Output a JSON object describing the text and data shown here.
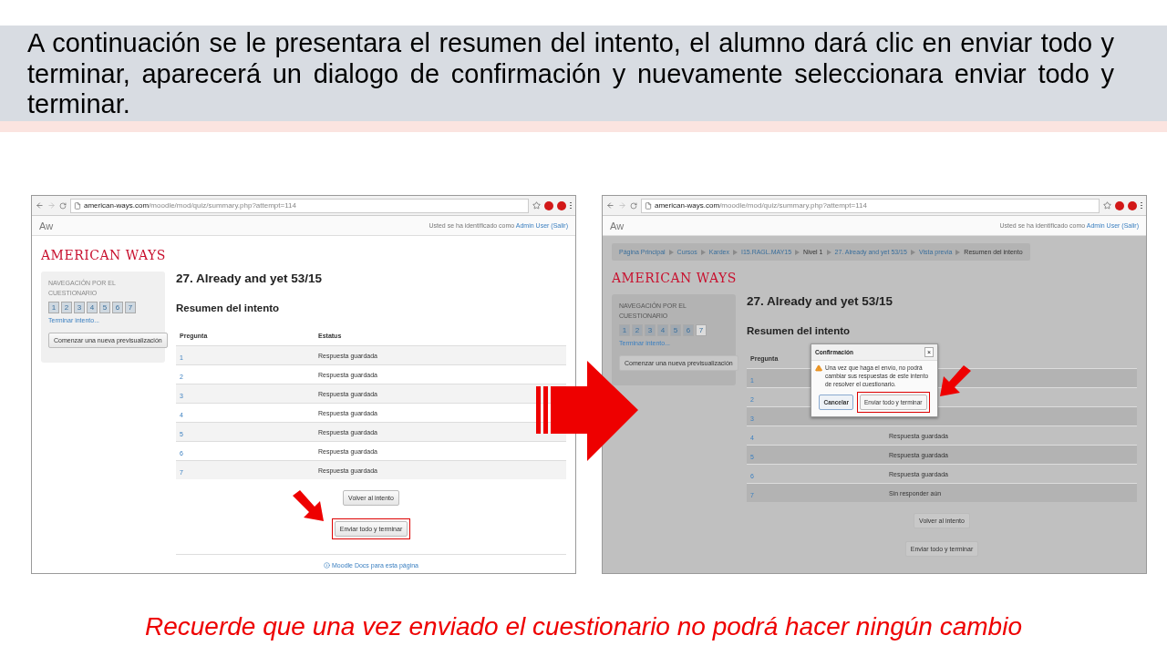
{
  "header": {
    "text": "A continuación se le presentara el resumen del intento, el alumno dará clic en enviar todo y terminar, aparecerá un dialogo de confirmación y nuevamente seleccionara enviar todo y terminar."
  },
  "screens": [
    {
      "dimmed": false,
      "url_host": "american-ways.com",
      "url_path": "/moodle/mod/quiz/summary.php?attempt=114",
      "brand": "Aw",
      "login_prefix": "Usted se ha identificado como",
      "login_user": "Admin User",
      "logout": "(Salir)",
      "logo": "AMERICAN WAYS",
      "nav": {
        "title": "NAVEGACIÓN POR EL CUESTIONARIO",
        "numbers": [
          {
            "label": "1",
            "answered": true
          },
          {
            "label": "2",
            "answered": true
          },
          {
            "label": "3",
            "answered": true
          },
          {
            "label": "4",
            "answered": true
          },
          {
            "label": "5",
            "answered": true
          },
          {
            "label": "6",
            "answered": true
          },
          {
            "label": "7",
            "answered": true
          }
        ],
        "finish_link": "Terminar intento...",
        "new_preview_button": "Comenzar una nueva previsualización"
      },
      "quiz_title": "27. Already and yet 53/15",
      "summary_title": "Resumen del intento",
      "columns": [
        "Pregunta",
        "Estatus"
      ],
      "rows": [
        {
          "number": "1",
          "status": "Respuesta guardada"
        },
        {
          "number": "2",
          "status": "Respuesta guardada"
        },
        {
          "number": "3",
          "status": "Respuesta guardada"
        },
        {
          "number": "4",
          "status": "Respuesta guardada"
        },
        {
          "number": "5",
          "status": "Respuesta guardada"
        },
        {
          "number": "6",
          "status": "Respuesta guardada"
        },
        {
          "number": "7",
          "status": "Respuesta guardada"
        }
      ],
      "buttons": [
        {
          "label": "Volver al intento",
          "highlighted": false
        },
        {
          "label": "Enviar todo y terminar",
          "highlighted": true
        }
      ],
      "footer_link": "Moodle Docs para esta página"
    },
    {
      "dimmed": true,
      "url_host": "american-ways.com",
      "url_path": "/moodle/mod/quiz/summary.php?attempt=114",
      "brand": "Aw",
      "login_prefix": "Usted se ha identificado como",
      "login_user": "Admin User",
      "logout": "(Salir)",
      "breadcrumb": [
        {
          "label": "Página Principal",
          "link": true
        },
        {
          "label": "Cursos",
          "link": true
        },
        {
          "label": "Kardex",
          "link": true
        },
        {
          "label": "I15.RAGL.MAY15",
          "link": true
        },
        {
          "label": "Nivel 1",
          "link": false
        },
        {
          "label": "27. Already and yet 53/15",
          "link": true
        },
        {
          "label": "Vista previa",
          "link": true
        },
        {
          "label": "Resumen del intento",
          "link": false
        }
      ],
      "logo": "AMERICAN WAYS",
      "nav": {
        "title": "NAVEGACIÓN POR EL CUESTIONARIO",
        "numbers": [
          {
            "label": "1",
            "answered": true
          },
          {
            "label": "2",
            "answered": true
          },
          {
            "label": "3",
            "answered": true
          },
          {
            "label": "4",
            "answered": true
          },
          {
            "label": "5",
            "answered": true
          },
          {
            "label": "6",
            "answered": true
          },
          {
            "label": "7",
            "answered": false
          }
        ],
        "finish_link": "Terminar intento...",
        "new_preview_button": "Comenzar una nueva previsualización"
      },
      "quiz_title": "27. Already and yet 53/15",
      "summary_title": "Resumen del intento",
      "columns": [
        "Pregunta"
      ],
      "rows": [
        {
          "number": "1"
        },
        {
          "number": "2"
        },
        {
          "number": "3"
        },
        {
          "number": "4",
          "status": "Respuesta guardada"
        },
        {
          "number": "5",
          "status": "Respuesta guardada"
        },
        {
          "number": "6",
          "status": "Respuesta guardada"
        },
        {
          "number": "7",
          "status": "Sin responder aún"
        }
      ],
      "buttons": [
        {
          "label": "Volver al intento",
          "highlighted": false
        },
        {
          "label": "Enviar todo y terminar",
          "highlighted": false
        }
      ],
      "dialog": {
        "title": "Confirmación",
        "close": "×",
        "message": "Una vez que haga el envío, no podrá cambiar sus respuestas de este intento de resolver el cuestionario.",
        "buttons": [
          {
            "label": "Cancelar",
            "kind": "cancel",
            "highlighted": false
          },
          {
            "label": "Enviar todo y terminar",
            "kind": "confirm",
            "highlighted": true
          }
        ]
      }
    }
  ],
  "footer_note": "Recuerde que una vez enviado el cuestionario no podrá hacer ningún cambio"
}
